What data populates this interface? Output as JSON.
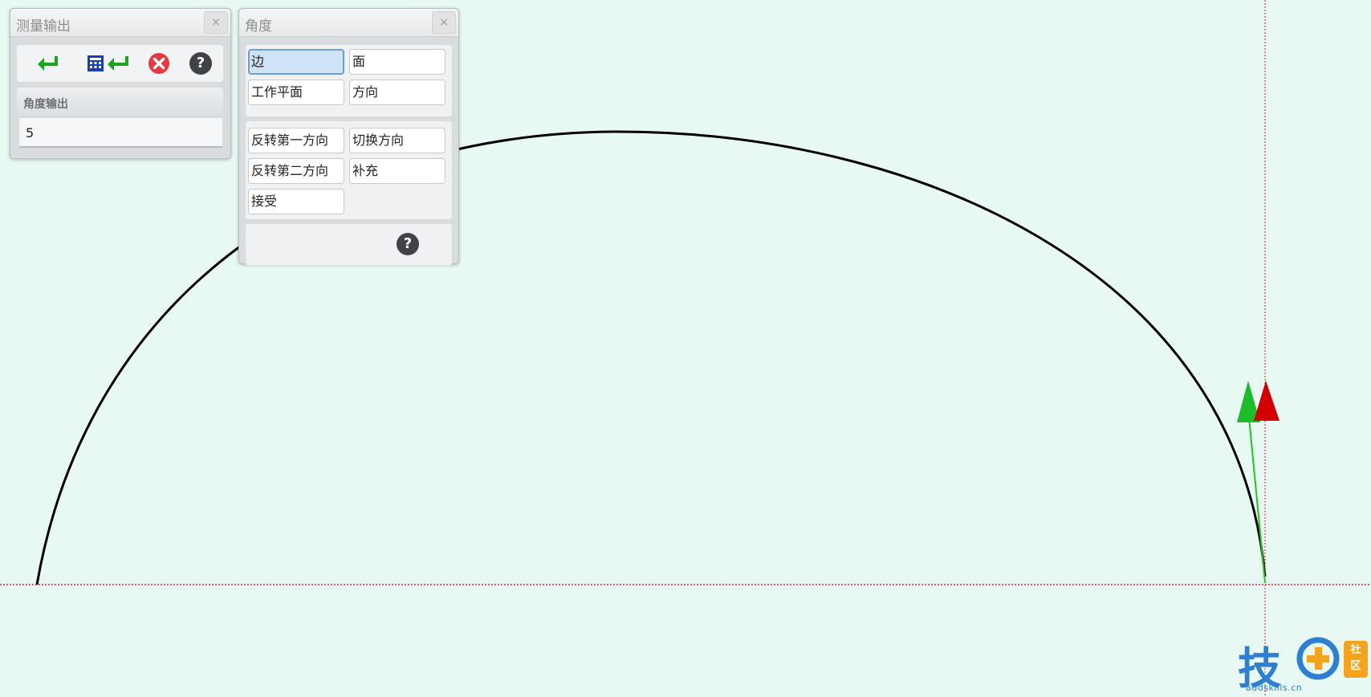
{
  "measure_panel": {
    "title": "测量输出",
    "close_label": "×",
    "toolbar": [
      "accept-icon",
      "calculator-accept-icon",
      "cancel-icon",
      "help-icon"
    ],
    "section_title": "角度输出",
    "value": "5"
  },
  "angle_panel": {
    "title": "角度",
    "close_label": "×",
    "buttons": {
      "edge": "边",
      "face": "面",
      "work_plane": "工作平面",
      "direction": "方向",
      "reverse_first": "反转第一方向",
      "switch_direction": "切换方向",
      "reverse_second": "反转第二方向",
      "supplement": "补充",
      "accept": "接受"
    },
    "help": "?"
  },
  "watermark": {
    "brand": "技",
    "badge": "社区",
    "domain": "addskills.cn"
  },
  "colors": {
    "background": "#e8f8f2",
    "arc": "#000000",
    "axis_line": "#e02020",
    "green_arrow": "#22c322",
    "red_arrow": "#d40000",
    "active_button": "#cfe3f7"
  }
}
